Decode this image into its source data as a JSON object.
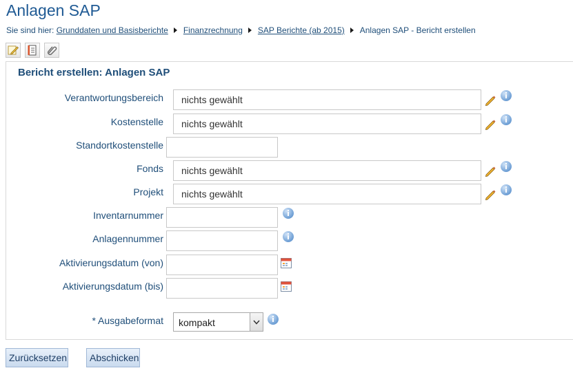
{
  "page": {
    "title": "Anlagen SAP"
  },
  "breadcrumb": {
    "prefix": "Sie sind hier:",
    "items": [
      "Grunddaten und Basisberichte",
      "Finanzrechnung",
      "SAP Berichte (ab 2015)"
    ],
    "current": "Anlagen SAP - Bericht erstellen"
  },
  "toolbar": {
    "icons": [
      "edit-icon",
      "form-list-icon",
      "paperclip-icon"
    ]
  },
  "form": {
    "title": "Bericht erstellen: Anlagen SAP",
    "fields": [
      {
        "label": "Verantwortungsbereich",
        "value": "nichts gewählt"
      },
      {
        "label": "Kostenstelle",
        "value": "nichts gewählt"
      },
      {
        "label": "Standortkostenstelle",
        "value": ""
      },
      {
        "label": "Fonds",
        "value": "nichts gewählt"
      },
      {
        "label": "Projekt",
        "value": "nichts gewählt"
      },
      {
        "label": "Inventarnummer",
        "value": ""
      },
      {
        "label": "Anlagennummer",
        "value": ""
      },
      {
        "label": "Aktivierungsdatum (von)",
        "value": ""
      },
      {
        "label": "Aktivierungsdatum (bis)",
        "value": ""
      }
    ],
    "output_format": {
      "label": "* Ausgabeformat",
      "selected": "kompakt"
    }
  },
  "buttons": {
    "reset": "Zurücksetzen",
    "submit": "Abschicken"
  },
  "colors": {
    "title": "#1f5a94",
    "text": "#1f4e79",
    "button_bg": "#c9daee",
    "info_icon": "#6e9fd5"
  }
}
